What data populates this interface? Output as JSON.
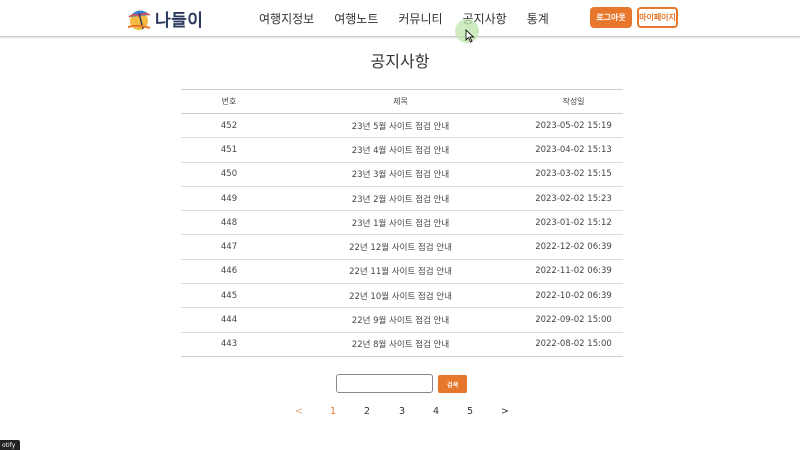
{
  "header": {
    "logo_text": "나들이",
    "nav": [
      "여행지정보",
      "여행노트",
      "커뮤니티",
      "공지사항",
      "통계"
    ],
    "logout_label": "로그아웃",
    "mypage_label": "마이페이지"
  },
  "page_title": "공지사항",
  "table": {
    "headers": [
      "번호",
      "제목",
      "작성일"
    ],
    "rows": [
      {
        "no": "452",
        "title": "23년 5월 사이트 점검 안내",
        "date": "2023-05-02 15:19"
      },
      {
        "no": "451",
        "title": "23년 4월 사이트 점검 안내",
        "date": "2023-04-02 15:13"
      },
      {
        "no": "450",
        "title": "23년 3월 사이트 점검 안내",
        "date": "2023-03-02 15:15"
      },
      {
        "no": "449",
        "title": "23년 2월 사이트 점검 안내",
        "date": "2023-02-02 15:23"
      },
      {
        "no": "448",
        "title": "23년 1월 사이트 점검 안내",
        "date": "2023-01-02 15:12"
      },
      {
        "no": "447",
        "title": "22년 12월 사이트 점검 안내",
        "date": "2022-12-02 06:39"
      },
      {
        "no": "446",
        "title": "22년 11월 사이트 점검 안내",
        "date": "2022-11-02 06:39"
      },
      {
        "no": "445",
        "title": "22년 10월 사이트 점검 안내",
        "date": "2022-10-02 06:39"
      },
      {
        "no": "444",
        "title": "22년 9월 사이트 점검 안내",
        "date": "2022-09-02 15:00"
      },
      {
        "no": "443",
        "title": "22년 8월 사이트 점검 안내",
        "date": "2022-08-02 15:00"
      }
    ]
  },
  "search": {
    "value": "",
    "button_label": "검색"
  },
  "pagination": {
    "prev": "<",
    "pages": [
      "1",
      "2",
      "3",
      "4",
      "5"
    ],
    "next": ">",
    "current": "1"
  },
  "corner_tag": "otify",
  "colors": {
    "accent": "#e8772e",
    "logo_text": "#2b3a5c"
  }
}
